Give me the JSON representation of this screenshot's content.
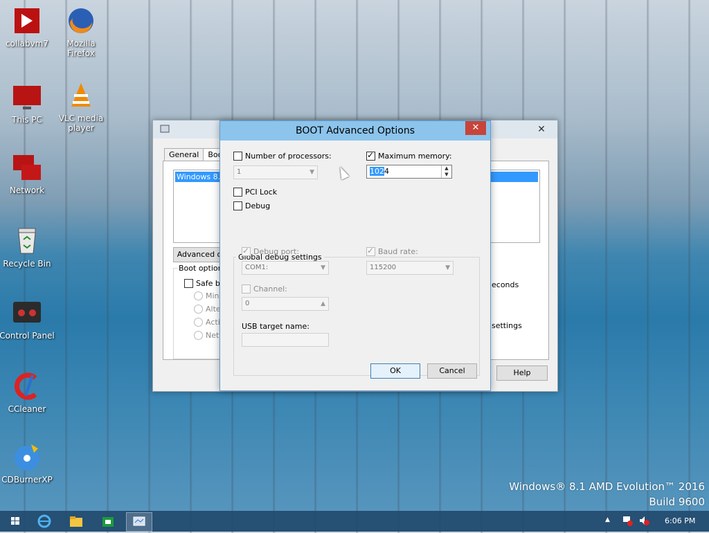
{
  "desktop": {
    "icons": [
      {
        "label": "collabvm7",
        "icon": "collabvm-icon"
      },
      {
        "label": "Mozilla Firefox",
        "icon": "firefox-icon"
      },
      {
        "label": "This PC",
        "icon": "this-pc-icon"
      },
      {
        "label": "VLC media player",
        "icon": "vlc-icon"
      },
      {
        "label": "Network",
        "icon": "network-icon"
      },
      {
        "label": "Recycle Bin",
        "icon": "recycle-bin-icon"
      },
      {
        "label": "Control Panel",
        "icon": "control-panel-icon"
      },
      {
        "label": "CCleaner",
        "icon": "ccleaner-icon"
      },
      {
        "label": "CDBurnerXP",
        "icon": "cdburnerxp-icon"
      }
    ],
    "watermark": {
      "line1": "Windows® 8.1 AMD Evolution™ 2016",
      "line2": "Build 9600"
    }
  },
  "msconfig": {
    "tabs": [
      "General",
      "Boot"
    ],
    "os_entry": "Windows 8.1",
    "advanced_label": "Advanced o",
    "boot_options_label": "Boot options",
    "safe_boot_label": "Safe bo",
    "radios": [
      "Mini",
      "Alter",
      "Activ",
      "Netv"
    ],
    "right_text_1": "econds",
    "right_text_2": "settings",
    "help_label": "Help"
  },
  "dialog": {
    "title": "BOOT Advanced Options",
    "num_processors": {
      "label": "Number of processors:",
      "checked": false,
      "value": "1"
    },
    "max_memory": {
      "label": "Maximum memory:",
      "checked": true,
      "value_selected": "102",
      "value_rest": "4"
    },
    "pci_lock": {
      "label": "PCI Lock",
      "checked": false
    },
    "debug": {
      "label": "Debug",
      "checked": false
    },
    "global_debug": {
      "group_label": "Global debug settings",
      "debug_port": {
        "label": "Debug port:",
        "checked": true,
        "value": "COM1:"
      },
      "baud_rate": {
        "label": "Baud rate:",
        "checked": true,
        "value": "115200"
      },
      "channel": {
        "label": "Channel:",
        "checked": false,
        "value": "0"
      },
      "usb_target": {
        "label": "USB target name:",
        "value": ""
      }
    },
    "ok_label": "OK",
    "cancel_label": "Cancel"
  },
  "taskbar": {
    "clock": "6:06 PM",
    "items": [
      "start-icon",
      "ie-icon",
      "file-explorer-icon",
      "store-icon",
      "msconfig-icon"
    ]
  }
}
